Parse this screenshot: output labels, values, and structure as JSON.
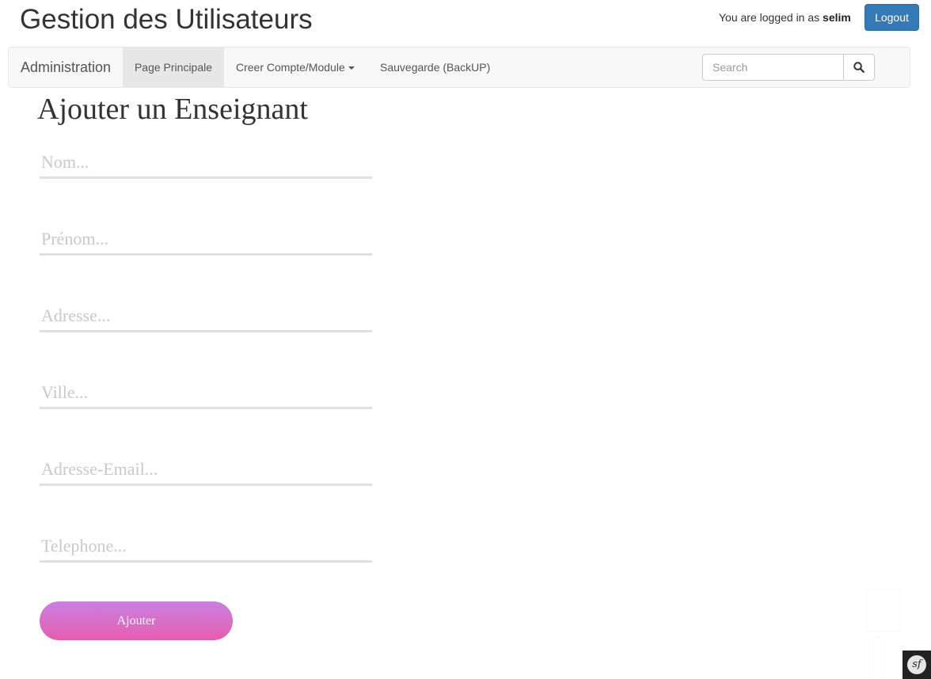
{
  "header": {
    "title": "Gestion des Utilisateurs",
    "login_prefix": "You are logged in as",
    "username": "selim",
    "logout_label": "Logout"
  },
  "navbar": {
    "brand": "Administration",
    "items": [
      {
        "label": "Page Principale",
        "active": true
      },
      {
        "label": "Creer Compte/Module",
        "dropdown": true
      },
      {
        "label": "Sauvegarde (BackUP)"
      }
    ],
    "search": {
      "placeholder": "Search",
      "value": "",
      "icon": "search-icon"
    }
  },
  "form": {
    "heading": "Ajouter un Enseignant",
    "fields": [
      {
        "placeholder": "Nom...",
        "value": ""
      },
      {
        "placeholder": "Prénom...",
        "value": ""
      },
      {
        "placeholder": "Adresse...",
        "value": ""
      },
      {
        "placeholder": "Ville...",
        "value": ""
      },
      {
        "placeholder": "Adresse-Email...",
        "value": ""
      },
      {
        "placeholder": "Telephone...",
        "value": ""
      }
    ],
    "submit_label": "Ajouter"
  },
  "debug_toolbar": {
    "icon": "symfony-icon",
    "glyph": "sf"
  },
  "colors": {
    "primary": "#337ab7",
    "navbar_bg": "#f8f8f8",
    "active_tab": "#e7e7e7",
    "button_gradient_top": "#c97fe2",
    "button_gradient_bottom": "#e65fae"
  }
}
